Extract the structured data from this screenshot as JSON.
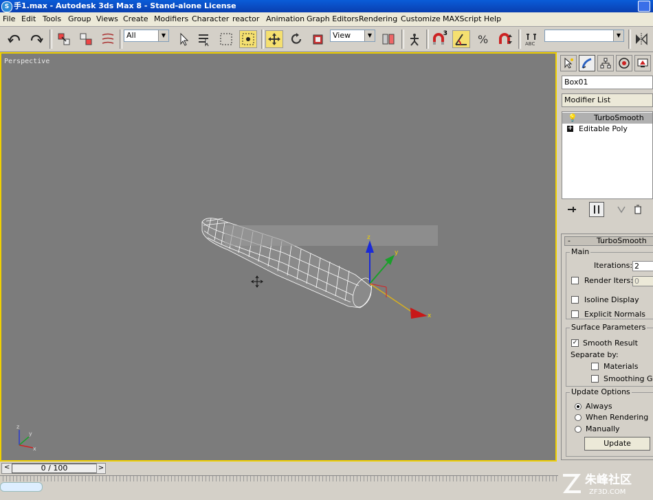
{
  "window": {
    "title": "手1.max - Autodesk 3ds Max 8  - Stand-alone License"
  },
  "menu": {
    "items": [
      "File",
      "Edit",
      "Tools",
      "Group",
      "Views",
      "Create",
      "Modifiers",
      "Character",
      "reactor",
      "Animation",
      "Graph Editors",
      "Rendering",
      "Customize",
      "MAXScript",
      "Help"
    ]
  },
  "toolbar": {
    "selection_filter": "All",
    "reference_coord": "View",
    "named_selection": "",
    "icons": [
      "undo-icon",
      "redo-icon",
      "select-and-link-icon",
      "unlink-icon",
      "bind-space-warp-icon",
      "select-object-icon",
      "select-by-name-icon",
      "rectangular-selection-icon",
      "window-crossing-icon",
      "select-and-move-icon",
      "select-and-rotate-icon",
      "select-and-scale-icon",
      "use-pivot-center-icon",
      "select-manipulate-icon",
      "snap-toggle-icon",
      "angle-snap-icon",
      "percent-snap-icon",
      "spinner-snap-icon",
      "edit-named-selections-icon",
      "mirror-icon"
    ],
    "snap_label": "3"
  },
  "viewport": {
    "label": "Perspective",
    "gizmo_x": "x",
    "gizmo_y": "y",
    "gizmo_z": "z",
    "axis_x": "x",
    "axis_y": "y",
    "axis_z": "z"
  },
  "command_panel": {
    "tabs": [
      "create-tab-icon",
      "modify-tab-icon",
      "hierarchy-tab-icon",
      "motion-tab-icon",
      "display-tab-icon"
    ],
    "object_name": "Box01",
    "modifier_list": "Modifier List",
    "stack": [
      {
        "name": "TurboSmooth",
        "icon": "lightbulb-icon",
        "selected": true
      },
      {
        "name": "Editable Poly",
        "icon": "plus-icon",
        "selected": false
      }
    ],
    "stack_buttons": [
      "pin-stack-icon",
      "show-end-result-icon",
      "make-unique-icon",
      "remove-modifier-icon",
      "configure-modifier-sets-icon"
    ]
  },
  "turbosmooth": {
    "rollout_sign": "-",
    "rollout_title": "TurboSmooth",
    "main": {
      "title": "Main",
      "iterations_label": "Iterations:",
      "iterations_value": "2",
      "render_iters_label": "Render Iters:",
      "render_iters_value": "0",
      "render_iters_checked": false
    },
    "isoline_display": {
      "label": "Isoline Display",
      "checked": false
    },
    "explicit_normals": {
      "label": "Explicit Normals",
      "checked": false
    },
    "surface": {
      "title": "Surface Parameters",
      "smooth_result": {
        "label": "Smooth Result",
        "checked": true
      },
      "separate_by": "Separate by:",
      "materials": {
        "label": "Materials",
        "checked": false
      },
      "smoothing_groups": {
        "label": "Smoothing Gro",
        "checked": false
      }
    },
    "update": {
      "title": "Update Options",
      "options": [
        "Always",
        "When Rendering",
        "Manually"
      ],
      "selected": "Always",
      "button": "Update"
    }
  },
  "timeline": {
    "frame_display": "0 / 100",
    "prev": "<",
    "next": ">"
  },
  "watermark": {
    "text": "朱峰社区",
    "sub": "ZF3D.COM"
  }
}
